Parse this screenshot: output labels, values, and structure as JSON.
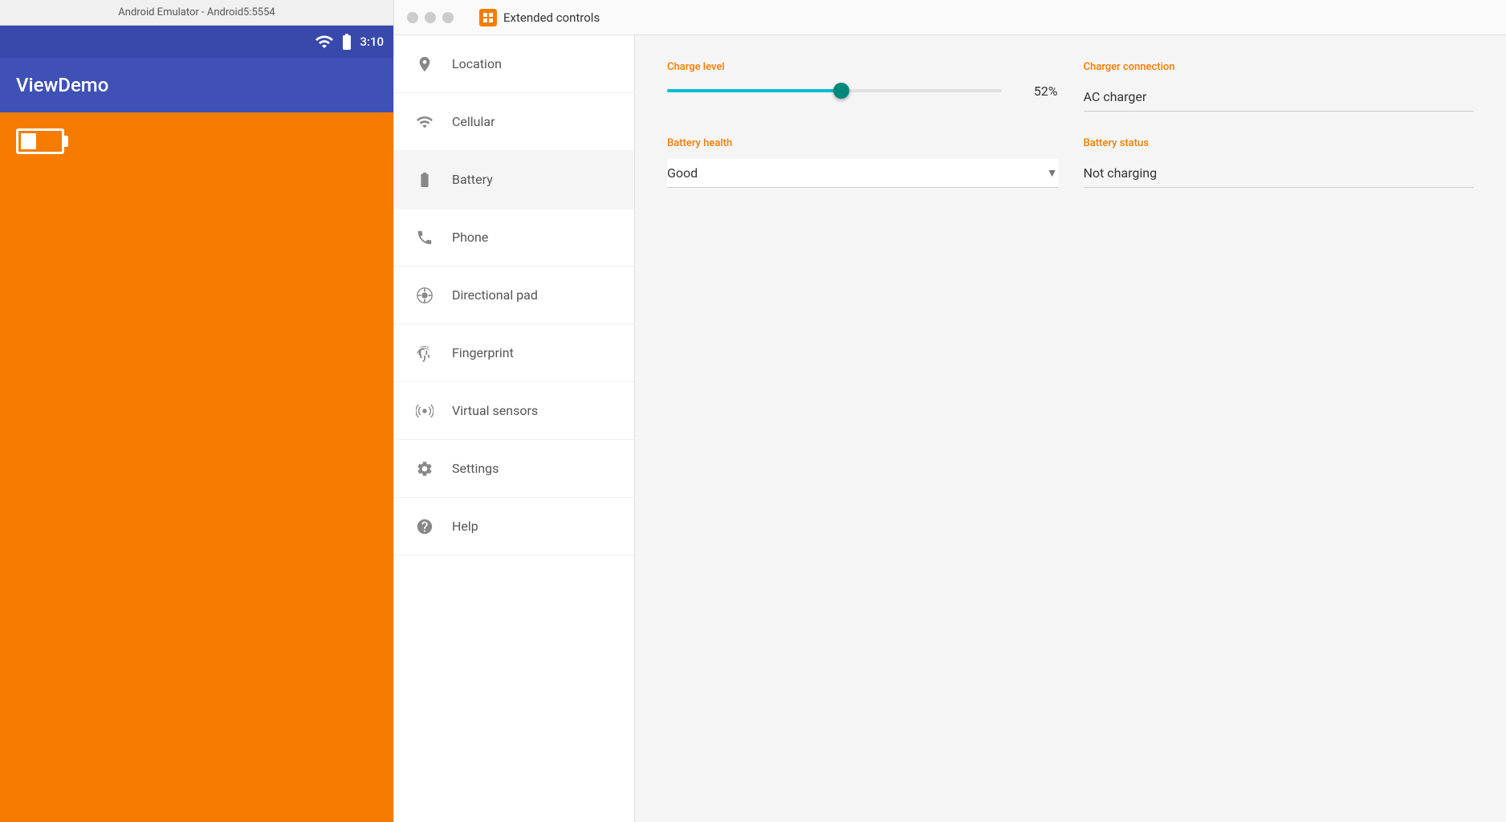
{
  "emulator": {
    "titlebar": "Android Emulator - Android5:5554",
    "statusbar": {
      "time": "3:10",
      "signal": "▲▲",
      "battery_icon": "battery"
    },
    "app": {
      "title": "ViewDemo"
    }
  },
  "extended_controls": {
    "title": "Extended controls",
    "logo_icon": "square-icon",
    "window_buttons": [
      "close",
      "minimize",
      "maximize"
    ],
    "sidebar": {
      "items": [
        {
          "id": "location",
          "label": "Location",
          "icon": "location-icon"
        },
        {
          "id": "cellular",
          "label": "Cellular",
          "icon": "cellular-icon"
        },
        {
          "id": "battery",
          "label": "Battery",
          "icon": "battery-icon",
          "active": true
        },
        {
          "id": "phone",
          "label": "Phone",
          "icon": "phone-icon"
        },
        {
          "id": "directional-pad",
          "label": "Directional pad",
          "icon": "dpad-icon"
        },
        {
          "id": "fingerprint",
          "label": "Fingerprint",
          "icon": "fingerprint-icon"
        },
        {
          "id": "virtual-sensors",
          "label": "Virtual sensors",
          "icon": "sensors-icon"
        },
        {
          "id": "settings",
          "label": "Settings",
          "icon": "settings-icon"
        },
        {
          "id": "help",
          "label": "Help",
          "icon": "help-icon"
        }
      ]
    },
    "battery_panel": {
      "charge_level_label": "Charge level",
      "charge_value": "52%",
      "charge_percent": 52,
      "charger_connection_label": "Charger connection",
      "charger_connection_value": "AC charger",
      "battery_health_label": "Battery health",
      "battery_health_value": "Good",
      "battery_status_label": "Battery status",
      "battery_status_value": "Not charging"
    }
  }
}
